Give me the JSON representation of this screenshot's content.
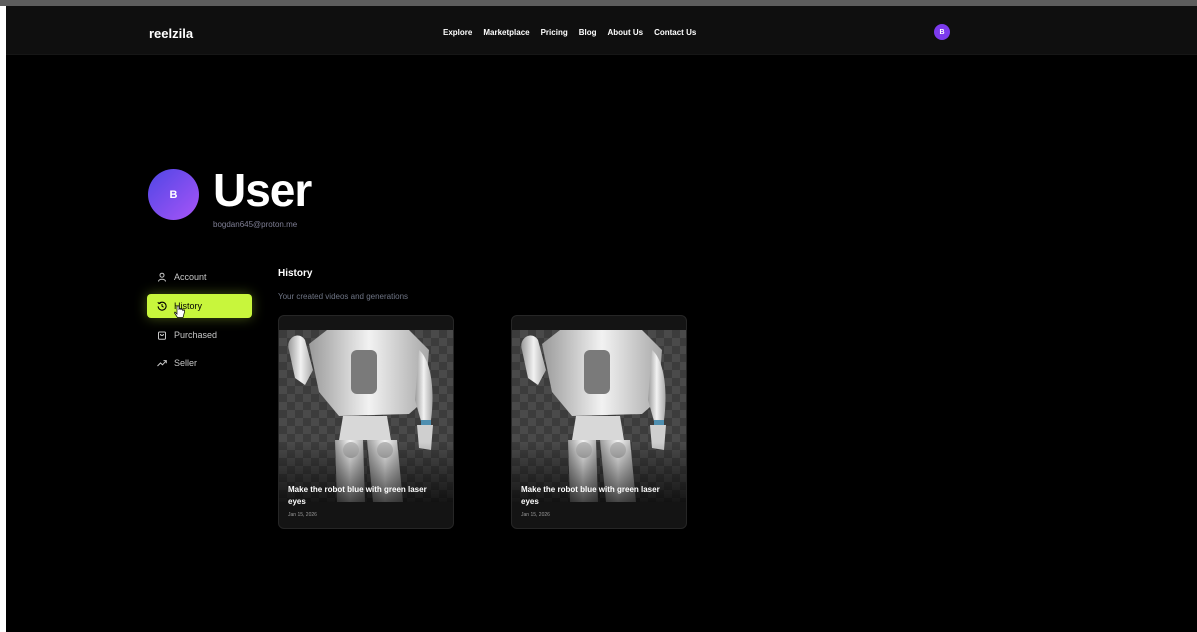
{
  "app": {
    "brand": "reelzila"
  },
  "nav": {
    "links": [
      "Explore",
      "Marketplace",
      "Pricing",
      "Blog",
      "About Us",
      "Contact Us"
    ],
    "avatar_initial": "B"
  },
  "profile": {
    "initial": "B",
    "name": "User",
    "email": "bogdan645@proton.me"
  },
  "sidebar": {
    "items": [
      {
        "label": "Account",
        "icon": "user-icon",
        "active": false
      },
      {
        "label": "History",
        "icon": "history-icon",
        "active": true
      },
      {
        "label": "Purchased",
        "icon": "bag-icon",
        "active": false
      },
      {
        "label": "Seller",
        "icon": "trend-icon",
        "active": false
      }
    ]
  },
  "history": {
    "title": "History",
    "subtitle": "Your created videos and generations",
    "cards": [
      {
        "title": "Make the robot blue with green laser eyes",
        "date": "Jan 15, 2026"
      },
      {
        "title": "Make the robot blue with green laser eyes",
        "date": "Jan 15, 2026"
      }
    ]
  },
  "colors": {
    "accent": "#c8f63c",
    "avatar": "#7c3aed",
    "background": "#000000"
  }
}
